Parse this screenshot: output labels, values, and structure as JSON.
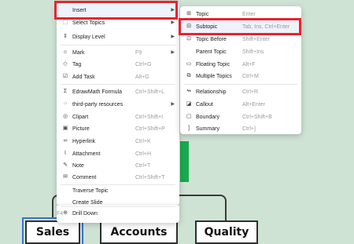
{
  "main_menu": {
    "items": [
      {
        "label": "Insert",
        "shortcut": "",
        "icon": "",
        "submenu": true,
        "highlighted": true
      },
      {
        "label": "Select Topics",
        "shortcut": "",
        "icon": "select-icon",
        "submenu": true
      },
      {
        "label": "Display Level",
        "shortcut": "",
        "icon": "display-level-icon",
        "submenu": true
      },
      {
        "label": "Mark",
        "shortcut": "F9",
        "icon": "mark-icon",
        "submenu": true
      },
      {
        "label": "Tag",
        "shortcut": "Ctrl+G",
        "icon": "tag-icon"
      },
      {
        "label": "Add Task",
        "shortcut": "Alt+G",
        "icon": "task-icon"
      },
      {
        "label": "EdrawMath Formula",
        "shortcut": "Ctrl+Shift+L",
        "icon": "formula-icon"
      },
      {
        "label": "third-party resources",
        "shortcut": "",
        "icon": "resources-icon",
        "submenu": true
      },
      {
        "label": "Clipart",
        "shortcut": "Ctrl+Shift+I",
        "icon": "clipart-icon"
      },
      {
        "label": "Picture",
        "shortcut": "Ctrl+Shift+P",
        "icon": "picture-icon"
      },
      {
        "label": "Hyperlink",
        "shortcut": "Ctrl+K",
        "icon": "hyperlink-icon"
      },
      {
        "label": "Attachment",
        "shortcut": "Ctrl+H",
        "icon": "attachment-icon"
      },
      {
        "label": "Note",
        "shortcut": "Ctrl+T",
        "icon": "note-icon"
      },
      {
        "label": "Comment",
        "shortcut": "Ctrl+Shift+T",
        "icon": "comment-icon"
      },
      {
        "label": "Traverse Topic",
        "shortcut": "",
        "icon": ""
      },
      {
        "label": "Create Slide",
        "shortcut": "",
        "icon": ""
      },
      {
        "label": "Drill Down",
        "shortcut": "F4",
        "icon": "drill-down-icon"
      }
    ]
  },
  "sub_menu": {
    "items": [
      {
        "label": "Topic",
        "shortcut": "Enter",
        "icon": "topic-icon"
      },
      {
        "label": "Subtopic",
        "shortcut": "Tab, Ins, Ctrl+Enter",
        "icon": "subtopic-icon",
        "highlighted": true
      },
      {
        "label": "Topic Before",
        "shortcut": "Shift+Enter",
        "icon": "topic-before-icon"
      },
      {
        "label": "Parent Topic",
        "shortcut": "Shift+Ins",
        "icon": ""
      },
      {
        "label": "Floating Topic",
        "shortcut": "Alt+F",
        "icon": "floating-topic-icon"
      },
      {
        "label": "Multiple Topics",
        "shortcut": "Ctrl+M",
        "icon": "multiple-topics-icon"
      },
      {
        "label": "Relationship",
        "shortcut": "Ctrl+R",
        "icon": "relationship-icon"
      },
      {
        "label": "Callout",
        "shortcut": "Alt+Enter",
        "icon": "callout-icon"
      },
      {
        "label": "Boundary",
        "shortcut": "Ctrl+Shift+B",
        "icon": "boundary-icon"
      },
      {
        "label": "Summary",
        "shortcut": "Ctrl+]",
        "icon": "summary-icon"
      }
    ]
  },
  "mindmap": {
    "topics": [
      "Sales",
      "Accounts",
      "Quality"
    ]
  },
  "colors": {
    "canvas": "#cfe3d5",
    "highlight_red": "#e8232e",
    "green_topic": "#1aa84e",
    "selection_blue": "#3b6fd8"
  }
}
